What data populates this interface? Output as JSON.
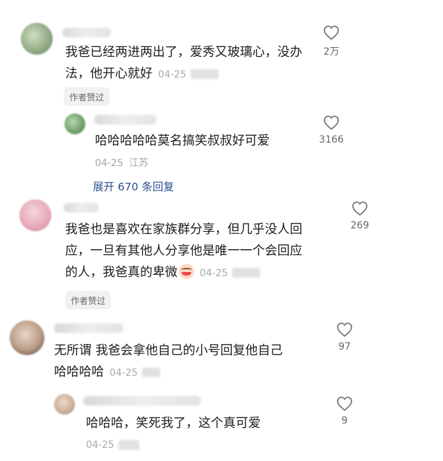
{
  "comments": [
    {
      "text_line1": "我爸已经两进两出了，爱秀又玻璃心，没办",
      "text_line2": "法，他开心就好",
      "date": "04-25",
      "likes": "2万",
      "tag": "作者赞过",
      "reply": {
        "text": "哈哈哈哈哈莫名搞笑叔叔好可爱",
        "date": "04-25",
        "location": "江苏",
        "likes": "3166",
        "expand": "展开 670 条回复"
      }
    },
    {
      "text_line1": "我爸也是喜欢在家族群分享，但几乎没人回",
      "text_line2": "应，一旦有其他人分享他是唯一一个会回应",
      "text_line3": "的人，我爸真的卑微",
      "date": "04-25",
      "likes": "269",
      "tag": "作者赞过",
      "emoji": "crying-laugh-emoji"
    },
    {
      "text_line1": "无所谓 我爸会拿他自己的小号回复他自己",
      "text_line2": "哈哈哈哈",
      "date": "04-25",
      "likes": "97",
      "reply": {
        "text": "哈哈哈，笑死我了，这个真可爱",
        "date": "04-25",
        "likes": "9"
      }
    }
  ],
  "colors": {
    "body_text": "#1c1c1c",
    "meta_text": "#a8a8a8",
    "link": "#2a4f8f",
    "tag_bg": "#f1f1f1"
  }
}
